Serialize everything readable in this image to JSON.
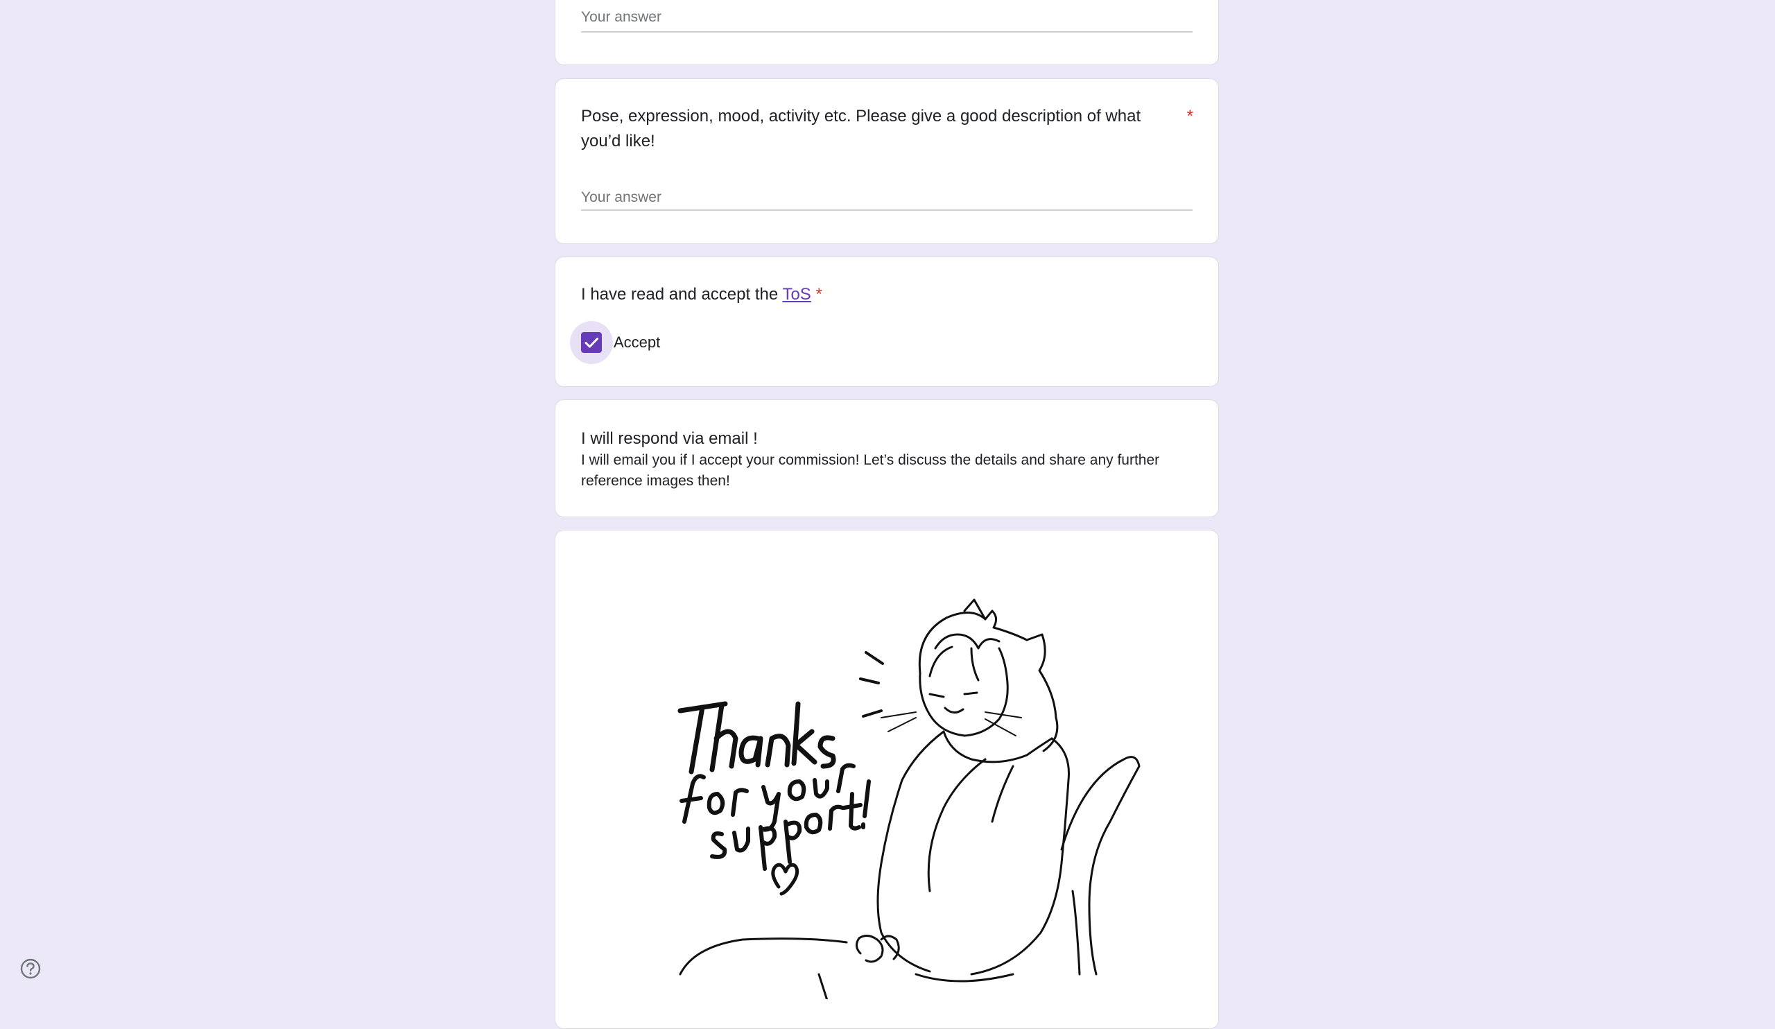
{
  "questions": {
    "prev_answer_placeholder": "Your answer",
    "pose": {
      "title": "Pose, expression, mood, activity etc. Please give a good description of what you’d like!",
      "required_mark": "*",
      "answer_placeholder": "Your answer"
    },
    "tos": {
      "title_prefix": "I have read and accept the ",
      "link_text": "ToS",
      "required_mark": "*",
      "option_label": "Accept",
      "checked": true
    }
  },
  "info_section": {
    "title": "I will respond via email !",
    "body": "I will email you if I accept your commission! Let’s discuss the details and share any further reference images then!"
  },
  "image_section": {
    "handwritten_text": "Thanks for your support!"
  },
  "colors": {
    "background": "#ede8f8",
    "accent": "#673ab7",
    "required": "#d93025"
  },
  "icons": {
    "help": "help-circle-icon",
    "check": "check-icon",
    "heart": "heart-icon"
  }
}
